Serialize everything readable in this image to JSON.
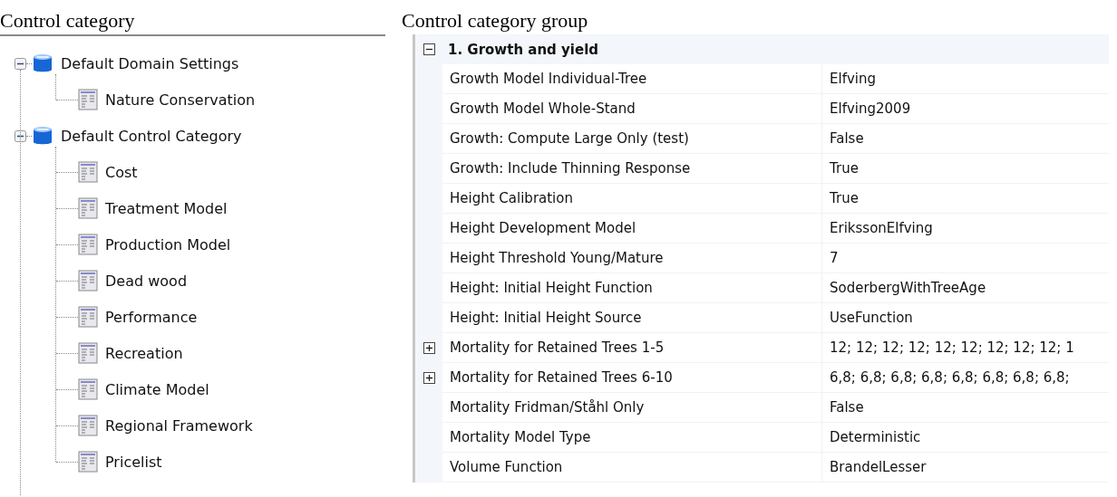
{
  "tree_panel": {
    "title": "Control category",
    "tree": [
      {
        "label": "Default Domain Settings",
        "kind": "domain",
        "expanded": true,
        "children": [
          {
            "label": "Nature Conservation",
            "kind": "form"
          }
        ]
      },
      {
        "label": "Default Control Category",
        "kind": "domain",
        "expanded": true,
        "children": [
          {
            "label": "Cost",
            "kind": "form"
          },
          {
            "label": "Treatment Model",
            "kind": "form"
          },
          {
            "label": "Production Model",
            "kind": "form"
          },
          {
            "label": "Dead wood",
            "kind": "form"
          },
          {
            "label": "Performance",
            "kind": "form"
          },
          {
            "label": "Recreation",
            "kind": "form"
          },
          {
            "label": "Climate Model",
            "kind": "form"
          },
          {
            "label": "Regional Framework",
            "kind": "form"
          },
          {
            "label": "Pricelist",
            "kind": "form"
          }
        ]
      }
    ]
  },
  "property_panel": {
    "title": "Control category group",
    "group": {
      "label": "1. Growth and yield",
      "expanded": true
    },
    "rows": [
      {
        "name": "Growth Model Individual-Tree",
        "value": "Elfving"
      },
      {
        "name": "Growth Model Whole-Stand",
        "value": "Elfving2009"
      },
      {
        "name": "Growth: Compute Large Only (test)",
        "value": "False"
      },
      {
        "name": "Growth: Include Thinning Response",
        "value": "True"
      },
      {
        "name": "Height Calibration",
        "value": "True"
      },
      {
        "name": "Height Development Model",
        "value": "ErikssonElfving"
      },
      {
        "name": "Height Threshold Young/Mature",
        "value": "7"
      },
      {
        "name": "Height: Initial Height Function",
        "value": "SoderbergWithTreeAge"
      },
      {
        "name": "Height: Initial Height Source",
        "value": "UseFunction"
      },
      {
        "name": "Mortality for Retained Trees 1-5",
        "value": "12; 12; 12; 12; 12; 12; 12; 12; 12; 1",
        "expanded": false
      },
      {
        "name": "Mortality for Retained Trees 6-10",
        "value": "6,8; 6,8; 6,8; 6,8; 6,8; 6,8; 6,8; 6,8;",
        "expanded": false
      },
      {
        "name": "Mortality Fridman/Ståhl Only",
        "value": "False"
      },
      {
        "name": "Mortality Model Type",
        "value": "Deterministic"
      },
      {
        "name": "Volume Function",
        "value": "BrandelLesser"
      }
    ]
  }
}
